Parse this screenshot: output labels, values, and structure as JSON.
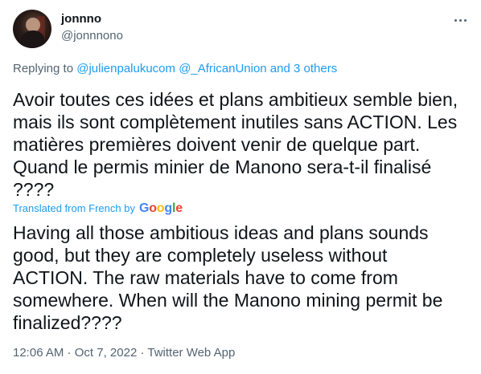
{
  "author": {
    "display_name": "jonnno",
    "handle": "@jonnnono"
  },
  "more_icon": "more-horizontal-icon",
  "reply": {
    "prefix": "Replying to ",
    "mention_1": "@julienpalukucom",
    "mention_2": "@_AfricanUnion",
    "connector": " and ",
    "others": "3 others"
  },
  "tweet": {
    "text": "Avoir toutes ces idées et plans ambitieux semble bien,\nmais ils sont complètement inutiles sans ACTION. Les\nmatières premières doivent venir de quelque part.\nQuand le permis minier de Manono sera-t-il finalisé\n????",
    "translated_label": "Translated from French by",
    "translator_logo": [
      "G",
      "o",
      "o",
      "g",
      "l",
      "e"
    ],
    "translation": "Having all those ambitious ideas and plans sounds\ngood, but they are completely useless without\nACTION. The raw materials have to come from\nsomewhere. When will the Manono mining permit be\nfinalized????"
  },
  "meta": {
    "time": "12:06 AM",
    "sep1": " · ",
    "date": "Oct 7, 2022",
    "sep2": " · ",
    "source": "Twitter Web App"
  },
  "colors": {
    "accent": "#1d9bf0",
    "secondary_text": "#536471",
    "primary_text": "#0f1419"
  }
}
